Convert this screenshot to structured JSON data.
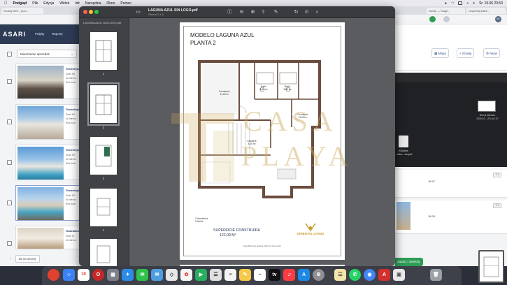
{
  "menubar": {
    "app_name": "Podgląd",
    "items": [
      "Plik",
      "Edycja",
      "Widok",
      "Idź",
      "Narzędzia",
      "Okno",
      "Pomoc"
    ],
    "clock": "Śr. 19.06 20:53"
  },
  "browser": {
    "tabs": [
      "Szukaj ofert - pros...",
      "Swoje — Skąpl...",
      "Uzupełnij kalen..."
    ],
    "asari": {
      "logo": "ASARI",
      "nav": [
        "Pulpity",
        "Raporty"
      ],
      "sort_select": "Mieszkanie sprzedaż",
      "listings": [
        {
          "title": "Torrevieja",
          "lines": [
            "Dost: MI",
            "Id Interno",
            "Rok budi"
          ]
        },
        {
          "title": "Torrevieja",
          "lines": [
            "Dost: MI",
            "Id Interno",
            "Rok budi"
          ]
        },
        {
          "title": "Torrevieja",
          "lines": [
            "Dost: MI",
            "Id Interno",
            "Rok budi"
          ]
        },
        {
          "title": "Torrevieja",
          "lines": [
            "Dost: MI",
            "Id Interno",
            "Rok budi"
          ]
        },
        {
          "title": "Guardama",
          "lines": [
            "Dost: M",
            "Id Interno",
            "Rok budi"
          ]
        }
      ],
      "page_size": "25 na stronę"
    },
    "right_panel": {
      "buttons": [
        "Mapa",
        "Szukaj",
        "Akcje"
      ],
      "avatar": "NZ",
      "screenshot_label": "Zrzut ekranu\n2024-0...23.44.17",
      "file_label": "Kliniela\n...niko...za.pdf",
      "rows": [
        {
          "time": "16:47",
          "badge": "T.1"
        },
        {
          "time": "16:24",
          "badge": "T.1"
        }
      ],
      "green_button": "Zapisz i zamknij"
    }
  },
  "preview": {
    "title": "LAGUNA AZUL SIN LOGO.pdf",
    "subtitle": "Strona 2 z 5",
    "sidebar_title": "LAGUNA AZUL SIN LOGO.pdf",
    "page_numbers": [
      "1",
      "2",
      "3",
      "4"
    ],
    "document": {
      "title_line1": "MODELO LAGUNA AZUL",
      "title_line2": "PLANTA 2",
      "rooms": [
        {
          "name": "Dormitorio",
          "size": "11,60 m²"
        },
        {
          "name": "Baño",
          "size": "3,80 m²"
        },
        {
          "name": "Baño",
          "size": "3,80 m²"
        },
        {
          "name": "Dormitorio",
          "size": "11,60 m²"
        },
        {
          "name": "Escalera",
          "size": "3,40 m²"
        }
      ],
      "note": "2 dormitorios\n2 baños",
      "superficie_label": "SUPERFICIE CONSTRUIDA",
      "superficie_value": "122,00 M²",
      "logo_text": "ORIENTAL LIVING",
      "footer": "Especificaciones sujetas a cambio sin previo aviso"
    }
  },
  "watermark": {
    "line1": "CASA",
    "line2": "PLAYA"
  },
  "dock": {
    "calendar_day": "19"
  }
}
